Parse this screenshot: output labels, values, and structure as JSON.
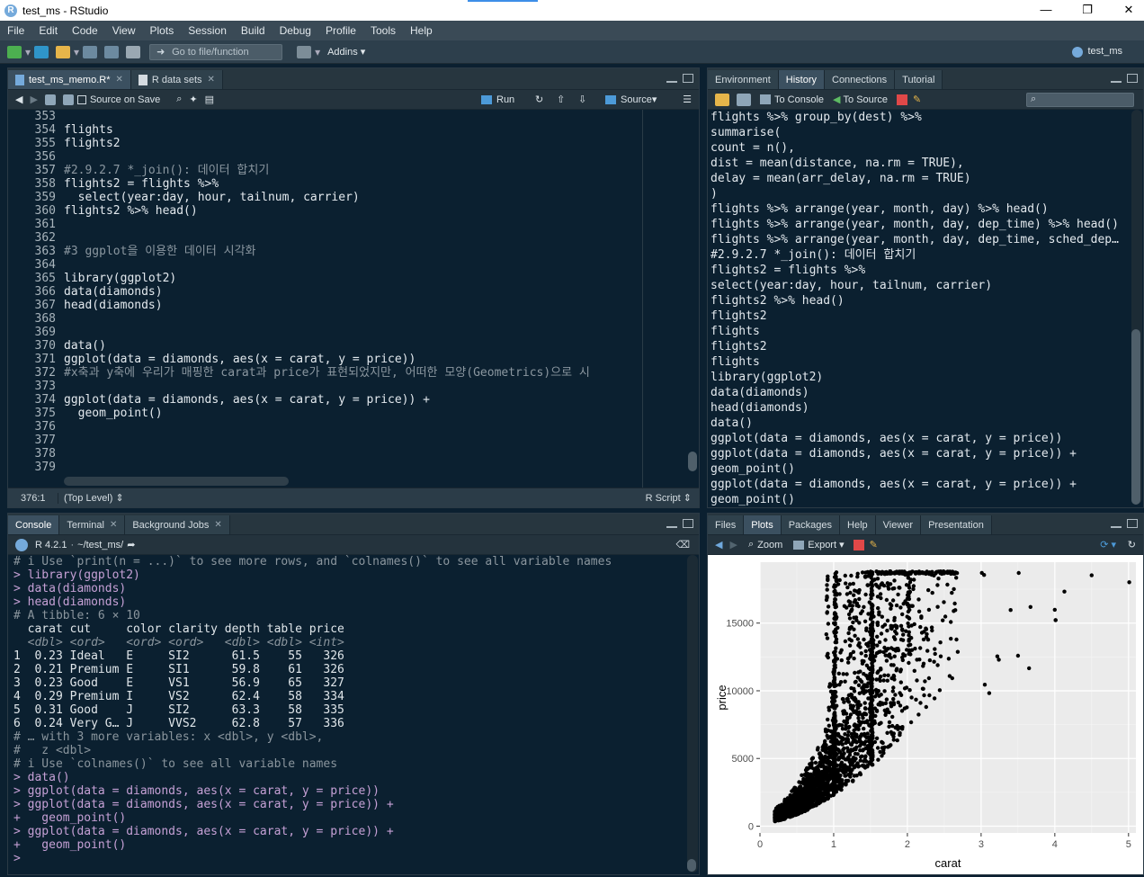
{
  "window": {
    "title": "test_ms - RStudio",
    "project": "test_ms"
  },
  "menu": [
    "File",
    "Edit",
    "Code",
    "View",
    "Plots",
    "Session",
    "Build",
    "Debug",
    "Profile",
    "Tools",
    "Help"
  ],
  "toolbar": {
    "goto_placeholder": "Go to file/function",
    "addins": "Addins"
  },
  "editor": {
    "tabs": [
      {
        "label": "test_ms_memo.R*"
      },
      {
        "label": "R data sets"
      }
    ],
    "tools": {
      "source_on_save": "Source on Save",
      "run": "Run",
      "source": "Source"
    },
    "line_numbers": [
      "353",
      "354",
      "355",
      "356",
      "357",
      "358",
      "359",
      "360",
      "361",
      "362",
      "363",
      "364",
      "365",
      "366",
      "367",
      "368",
      "369",
      "370",
      "371",
      "372",
      "373",
      "374",
      "375",
      "376",
      "377",
      "378",
      "379"
    ],
    "lines": [
      "",
      "flights",
      "flights2",
      "",
      "#2.9.2.7 *_join(): 데이터 합치기",
      "flights2 = flights %>%",
      "  select(year:day, hour, tailnum, carrier)",
      "flights2 %>% head()",
      "",
      "",
      "#3 ggplot을 이용한 데이터 시각화",
      "",
      "library(ggplot2)",
      "data(diamonds)",
      "head(diamonds)",
      "",
      "",
      "data()",
      "ggplot(data = diamonds, aes(x = carat, y = price))",
      "#x축과 y축에 우리가 매핑한 carat과 price가 표현되었지만, 어떠한 모양(Geometrics)으로 시",
      "",
      "ggplot(data = diamonds, aes(x = carat, y = price)) +",
      "  geom_point()",
      "",
      "",
      "",
      ""
    ],
    "status": {
      "position": "376:1",
      "scope": "(Top Level)",
      "type": "R Script"
    }
  },
  "env_pane": {
    "tabs": [
      {
        "label": "Environment"
      },
      {
        "label": "History"
      },
      {
        "label": "Connections"
      },
      {
        "label": "Tutorial"
      }
    ],
    "tools": {
      "to_console": "To Console",
      "to_source": "To Source"
    },
    "history": [
      "flights %>% group_by(dest) %>%",
      "summarise(",
      "count = n(),",
      "dist = mean(distance, na.rm = TRUE),",
      "delay = mean(arr_delay, na.rm = TRUE)",
      ")",
      "flights %>% arrange(year, month, day) %>% head()",
      "flights %>% arrange(year, month, day, dep_time) %>% head()",
      "flights %>% arrange(year, month, day, dep_time, sched_dep…",
      "#2.9.2.7 *_join(): 데이터 합치기",
      "flights2 = flights %>%",
      "select(year:day, hour, tailnum, carrier)",
      "flights2 %>% head()",
      "flights2",
      "flights",
      "flights2",
      "flights",
      "library(ggplot2)",
      "data(diamonds)",
      "head(diamonds)",
      "data()",
      "ggplot(data = diamonds, aes(x = carat, y = price))",
      "ggplot(data = diamonds, aes(x = carat, y = price)) +",
      "geom_point()",
      "ggplot(data = diamonds, aes(x = carat, y = price)) +",
      "geom_point()"
    ]
  },
  "console_pane": {
    "tabs": [
      {
        "label": "Console"
      },
      {
        "label": "Terminal"
      },
      {
        "label": "Background Jobs"
      }
    ],
    "r_version": "R 4.2.1",
    "path": "~/test_ms/",
    "lines": [
      {
        "cls": "c-cm",
        "text": "# i Use `print(n = ...)` to see more rows, and `colnames()` to see all variable names"
      },
      {
        "cls": "c-in",
        "text": "> library(ggplot2)"
      },
      {
        "cls": "c-in",
        "text": "> data(diamonds)"
      },
      {
        "cls": "c-in",
        "text": "> head(diamonds)"
      },
      {
        "cls": "c-cm",
        "text": "# A tibble: 6 × 10"
      },
      {
        "cls": "c-out",
        "text": "  carat cut     color clarity depth table price"
      },
      {
        "cls": "c-type",
        "text": "  <dbl> <ord>   <ord> <ord>   <dbl> <dbl> <int>"
      },
      {
        "cls": "c-out",
        "text": "1  0.23 Ideal   E     SI2      61.5    55   326"
      },
      {
        "cls": "c-out",
        "text": "2  0.21 Premium E     SI1      59.8    61   326"
      },
      {
        "cls": "c-out",
        "text": "3  0.23 Good    E     VS1      56.9    65   327"
      },
      {
        "cls": "c-out",
        "text": "4  0.29 Premium I     VS2      62.4    58   334"
      },
      {
        "cls": "c-out",
        "text": "5  0.31 Good    J     SI2      63.3    58   335"
      },
      {
        "cls": "c-out",
        "text": "6  0.24 Very G… J     VVS2     62.8    57   336"
      },
      {
        "cls": "c-cm",
        "text": "# … with 3 more variables: x <dbl>, y <dbl>,"
      },
      {
        "cls": "c-cm",
        "text": "#   z <dbl>"
      },
      {
        "cls": "c-cm",
        "text": "# i Use `colnames()` to see all variable names"
      },
      {
        "cls": "c-in",
        "text": "> data()"
      },
      {
        "cls": "c-in",
        "text": "> ggplot(data = diamonds, aes(x = carat, y = price))"
      },
      {
        "cls": "c-in",
        "text": "> ggplot(data = diamonds, aes(x = carat, y = price)) +"
      },
      {
        "cls": "c-in",
        "text": "+   geom_point()"
      },
      {
        "cls": "c-in",
        "text": "> ggplot(data = diamonds, aes(x = carat, y = price)) +"
      },
      {
        "cls": "c-in",
        "text": "+   geom_point()"
      },
      {
        "cls": "c-in",
        "text": "> "
      }
    ]
  },
  "files_pane": {
    "tabs": [
      {
        "label": "Files"
      },
      {
        "label": "Plots"
      },
      {
        "label": "Packages"
      },
      {
        "label": "Help"
      },
      {
        "label": "Viewer"
      },
      {
        "label": "Presentation"
      }
    ],
    "tools": {
      "zoom": "Zoom",
      "export": "Export"
    }
  },
  "chart_data": {
    "type": "scatter",
    "xlabel": "carat",
    "ylabel": "price",
    "xlim": [
      0,
      5.1
    ],
    "ylim": [
      -500,
      19500
    ],
    "xticks": [
      0,
      1,
      2,
      3,
      4,
      5
    ],
    "yticks": [
      0,
      5000,
      10000,
      15000
    ],
    "ytick_labels": [
      "0",
      "5000",
      "10000",
      "15000"
    ],
    "grid": true,
    "outliers": [
      [
        3.01,
        18710
      ],
      [
        3.05,
        10453
      ],
      [
        3.11,
        9823
      ],
      [
        3.4,
        15964
      ],
      [
        3.5,
        12587
      ],
      [
        3.51,
        18701
      ],
      [
        3.65,
        11668
      ],
      [
        3.67,
        16193
      ],
      [
        4,
        15984
      ],
      [
        4.01,
        15223
      ],
      [
        4.01,
        15223
      ],
      [
        4.13,
        17329
      ],
      [
        4.5,
        18531
      ],
      [
        5.01,
        18018
      ],
      [
        3.22,
        12545
      ],
      [
        3.24,
        12300
      ],
      [
        3.04,
        18559
      ]
    ],
    "color": "#000000",
    "panel_bg": "#ebebeb"
  }
}
